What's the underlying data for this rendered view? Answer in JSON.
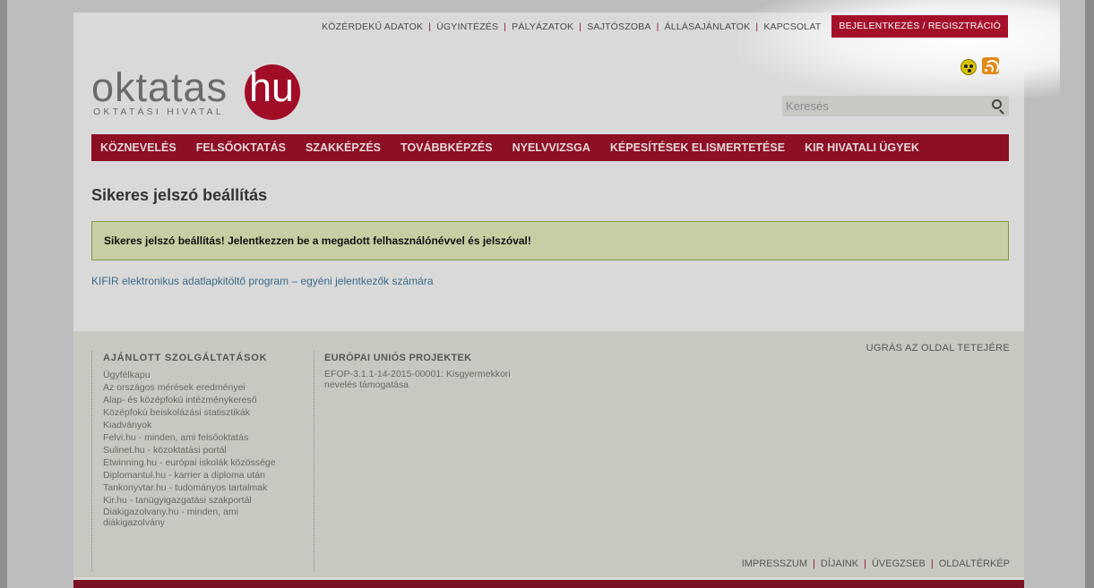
{
  "top_nav": {
    "items": [
      "KÖZÉRDEKŰ ADATOK",
      "ÜGYINTÉZÉS",
      "PÁLYÁZATOK",
      "SAJTÓSZOBA",
      "ÁLLÁSAJÁNLATOK",
      "KAPCSOLAT"
    ],
    "login_label": "BEJELENTKEZÉS / REGISZTRÁCIÓ"
  },
  "logo": {
    "word": "oktatas",
    "suffix": "hu",
    "tagline": "OKTATÁSI HIVATAL"
  },
  "icons": {
    "accessibility": "accessibility-icon",
    "rss": "rss-icon",
    "search": "search-icon"
  },
  "search": {
    "placeholder": "Keresés"
  },
  "main_nav": {
    "items": [
      "KÖZNEVELÉS",
      "FELSŐOKTATÁS",
      "SZAKKÉPZÉS",
      "TOVÁBBKÉPZÉS",
      "NYELVVIZSGA",
      "KÉPESÍTÉSEK ELISMERTETÉSE",
      "KIR HIVATALI ÜGYEK"
    ]
  },
  "content": {
    "title": "Sikeres jelszó beállítás",
    "alert": "Sikeres jelszó beállítás! Jelentkezzen be a megadott felhasználónévvel és jelszóval!",
    "link": "KIFIR elektronikus adatlapkitöltő program – egyéni jelentkezők számára"
  },
  "footer": {
    "services_heading": "AJÁNLOTT SZOLGÁLTATÁSOK",
    "services": [
      "Ügyfélkapu",
      "Az országos mérések eredményei",
      "Alap- és középfokú intézménykereső",
      "Középfokú beiskolázási statisztikák",
      "Kiadványok",
      "Felvi.hu - minden, ami felsőoktatás",
      "Sulinet.hu - közoktatási portál",
      "Etwinning.hu - európai iskolák közössége",
      "Diplomantul.hu - karrier a diploma után",
      "Tankonyvtar.hu - tudományos tartalmak",
      "Kir.hu - tanügyigazgatási szakportál",
      "Diakigazolvany.hu - minden, ami",
      "diákigazolvány"
    ],
    "eu_heading": "EURÓPAI UNIÓS PROJEKTEK",
    "eu_projects": [
      "EFOP-3.1.1-14-2015-00001: Kisgyermekkori",
      "nevelés támogatása"
    ],
    "top_link": "UGRÁS AZ OLDAL TETEJÉRE",
    "bottom_nav": [
      "IMPRESSZUM",
      "DÍJAINK",
      "ÜVEGZSEB",
      "OLDALTÉRKÉP"
    ]
  },
  "colors": {
    "brand_red": "#a4102a",
    "nav_red": "#8c0f24",
    "alert_bg": "#c6cfa3",
    "alert_border": "#7f9a3c",
    "link": "#3a6a8a"
  }
}
